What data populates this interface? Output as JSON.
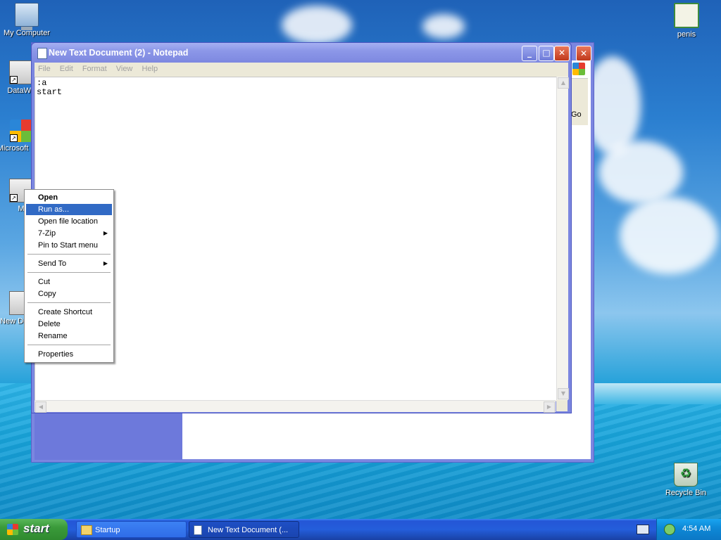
{
  "desktop": {
    "icons": [
      {
        "label": "My Computer",
        "icon": "my-computer-icon"
      },
      {
        "label": "DataWa",
        "icon": "datawa-shortcut-icon"
      },
      {
        "label": "Microsoft C++",
        "icon": "microsoft-cpp-shortcut-icon"
      },
      {
        "label": "M",
        "icon": "shortcut-icon"
      },
      {
        "label": "New Docum",
        "icon": "text-document-icon"
      },
      {
        "label": "penis",
        "icon": "certificate-icon"
      },
      {
        "label": "Recycle Bin",
        "icon": "recycle-bin-icon"
      }
    ]
  },
  "background_window": {
    "go_label": "Go"
  },
  "notepad": {
    "title": "New Text Document (2) - Notepad",
    "menu": [
      "File",
      "Edit",
      "Format",
      "View",
      "Help"
    ],
    "content": ":a\nstart",
    "buttons": {
      "minimize": "_",
      "maximize": "□",
      "close": "✕"
    }
  },
  "context_menu": {
    "items": [
      "Open",
      "Run as...",
      "Open file location",
      "7-Zip",
      "Pin to Start menu",
      "Send To",
      "Cut",
      "Copy",
      "Create Shortcut",
      "Delete",
      "Rename",
      "Properties"
    ],
    "selected": "Run as...",
    "submenu_arrow": "▶"
  },
  "taskbar": {
    "start_label": "start",
    "tasks": [
      "Startup",
      "New Text Document (..."
    ],
    "clock": "4:54 AM"
  },
  "colors": {
    "selection": "#316ac5",
    "titlebar_inactive": "#7b86e0",
    "taskbar": "#245edb",
    "start_button": "#3a9a3a"
  }
}
